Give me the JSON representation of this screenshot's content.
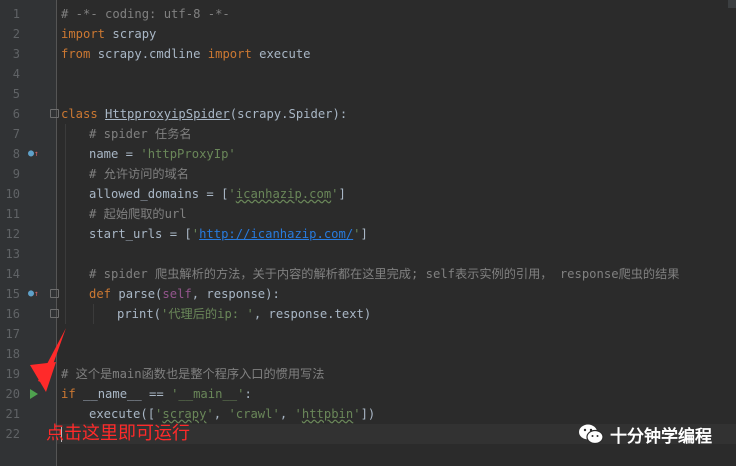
{
  "lines": [
    {
      "n": "1"
    },
    {
      "n": "2"
    },
    {
      "n": "3"
    },
    {
      "n": "4"
    },
    {
      "n": "5"
    },
    {
      "n": "6"
    },
    {
      "n": "7"
    },
    {
      "n": "8"
    },
    {
      "n": "9"
    },
    {
      "n": "10"
    },
    {
      "n": "11"
    },
    {
      "n": "12"
    },
    {
      "n": "13"
    },
    {
      "n": "14"
    },
    {
      "n": "15"
    },
    {
      "n": "16"
    },
    {
      "n": "17"
    },
    {
      "n": "18"
    },
    {
      "n": "19"
    },
    {
      "n": "20"
    },
    {
      "n": "21"
    },
    {
      "n": "22"
    }
  ],
  "code": {
    "l1": "# -*- coding: utf-8 -*-",
    "l2_kw": "import",
    "l2_rest": " scrapy",
    "l3_kw1": "from",
    "l3_mod": " scrapy.cmdline ",
    "l3_kw2": "import",
    "l3_rest": " execute",
    "l6_kw": "class",
    "l6_sp": " ",
    "l6_cls": "HttpproxyipSpider",
    "l6_rest": "(scrapy.Spider):",
    "l7": "# spider 任务名",
    "l8_a": "name = ",
    "l8_str": "'httpProxyIp'",
    "l9": "# 允许访问的域名",
    "l10_a": "allowed_domains = [",
    "l10_q1": "'",
    "l10_str": "icanhazip.com",
    "l10_q2": "'",
    "l10_b": "]",
    "l11": "# 起始爬取的url",
    "l12_a": "start_urls = [",
    "l12_q1": "'",
    "l12_url": "http://icanhazip.com/",
    "l12_q2": "'",
    "l12_b": "]",
    "l14": "# spider 爬虫解析的方法，关于内容的解析都在这里完成; self表示实例的引用， response爬虫的结果",
    "l15_kw": "def",
    "l15_fn": " parse(",
    "l15_self": "self",
    "l15_rest": ", response):",
    "l16_a": "print(",
    "l16_str": "'代理后的ip: '",
    "l16_b": ", response.text)",
    "l19": "# 这个是main函数也是整个程序入口的惯用写法",
    "l20_kw": "if",
    "l20_a": " __name__ == ",
    "l20_str": "'__main__'",
    "l20_b": ":",
    "l21_a": "execute([",
    "l21_s1q": "'",
    "l21_s1": "scrapy",
    "l21_s1q2": "'",
    "l21_c1": ", ",
    "l21_s2": "'crawl'",
    "l21_c2": ", ",
    "l21_s3q": "'",
    "l21_s3": "httpbin",
    "l21_s3q2": "'",
    "l21_b": "])"
  },
  "annotation": "点击这里即可运行",
  "watermark": "十分钟学编程",
  "icons": {
    "run": "run-arrow-icon",
    "override": "override-method-icon",
    "wechat": "wechat-logo-icon"
  },
  "colors": {
    "background": "#2b2b2b",
    "keyword": "#cc7832",
    "string": "#6a8759",
    "comment": "#808080",
    "annotation": "#ff2a2a",
    "run": "#4ea14e"
  }
}
